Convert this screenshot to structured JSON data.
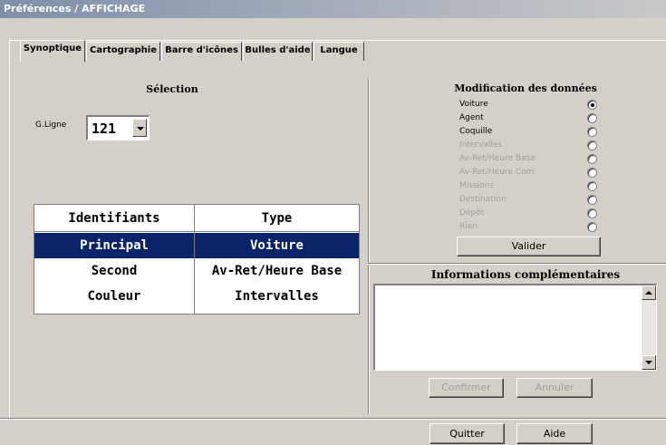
{
  "window": {
    "title": "Préférences / AFFICHAGE"
  },
  "tabs": [
    {
      "label": "Synoptique",
      "active": true
    },
    {
      "label": "Cartographie",
      "active": false
    },
    {
      "label": "Barre d'icônes",
      "active": false
    },
    {
      "label": "Bulles d'aide",
      "active": false
    },
    {
      "label": "Langue",
      "active": false
    }
  ],
  "selection": {
    "title": "Sélection",
    "gline_label": "G.Ligne",
    "gline_value": "121",
    "table": {
      "headers": [
        "Identifiants",
        "Type"
      ],
      "rows": [
        {
          "id": "Principal",
          "type": "Voiture",
          "selected": true
        },
        {
          "id": "Second",
          "type": "Av-Ret/Heure Base",
          "selected": false
        },
        {
          "id": "Couleur",
          "type": "Intervalles",
          "selected": false
        }
      ]
    }
  },
  "modification": {
    "title": "Modification des données",
    "options": [
      {
        "label": "Voiture",
        "checked": true,
        "enabled": true
      },
      {
        "label": "Agent",
        "checked": false,
        "enabled": true
      },
      {
        "label": "Coquille",
        "checked": false,
        "enabled": true
      },
      {
        "label": "Intervalles",
        "checked": false,
        "enabled": false
      },
      {
        "label": "Av-Ret/Heure Base",
        "checked": false,
        "enabled": false
      },
      {
        "label": "Av-Ret/Heure Com",
        "checked": false,
        "enabled": false
      },
      {
        "label": "Missions",
        "checked": false,
        "enabled": false
      },
      {
        "label": "Destination",
        "checked": false,
        "enabled": false
      },
      {
        "label": "Dépôt",
        "checked": false,
        "enabled": false
      },
      {
        "label": "Rien",
        "checked": false,
        "enabled": false
      }
    ],
    "validate_label": "Valider"
  },
  "info": {
    "title": "Informations complémentaires",
    "text": "",
    "confirm_label": "Confirmer",
    "cancel_label": "Annuler"
  },
  "footer": {
    "quit_label": "Quitter",
    "help_label": "Aide"
  }
}
